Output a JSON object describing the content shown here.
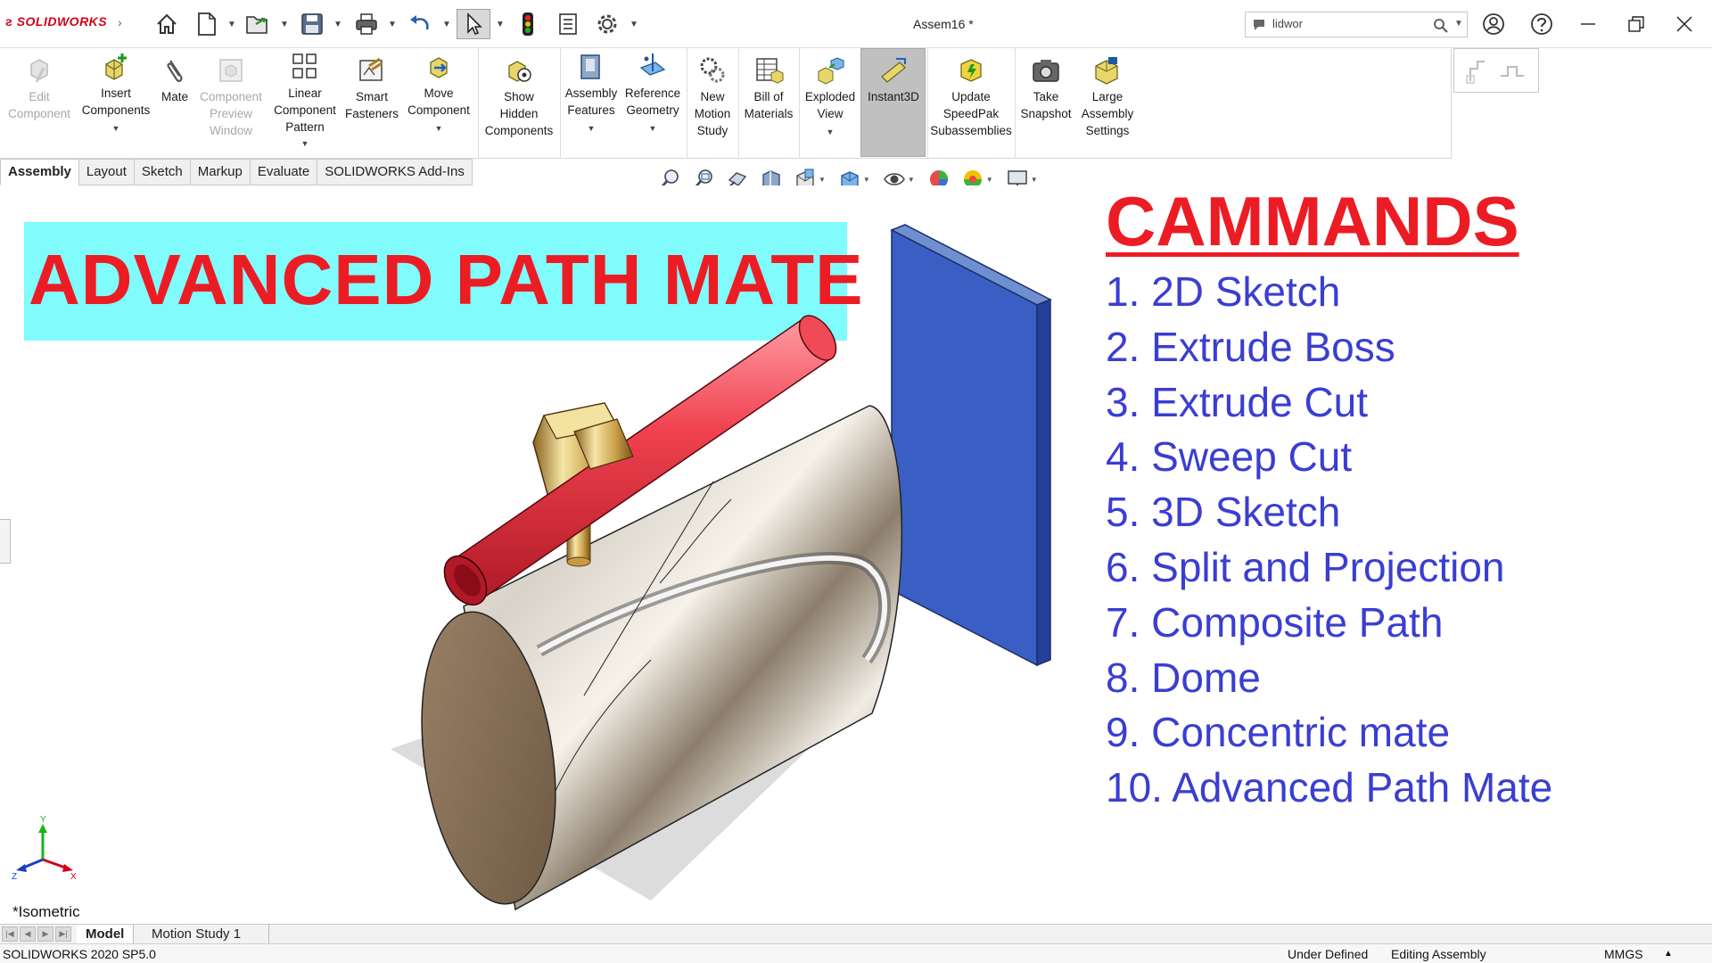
{
  "app": {
    "brand": "SOLIDWORKS",
    "doc_title": "Assem16 *"
  },
  "search": {
    "value": "lidwor"
  },
  "quick_access": {
    "icons": [
      "home-icon",
      "new-document-icon",
      "open-icon",
      "save-icon",
      "print-icon",
      "undo-icon",
      "select-icon",
      "rebuild-icon",
      "file-properties-icon",
      "options-icon"
    ]
  },
  "ribbon": {
    "edit_component": [
      "Edit",
      "Component"
    ],
    "insert_components": [
      "Insert",
      "Components"
    ],
    "mate": [
      "Mate"
    ],
    "component_preview": [
      "Component",
      "Preview",
      "Window"
    ],
    "linear_pattern": [
      "Linear",
      "Component",
      "Pattern"
    ],
    "smart_fasteners": [
      "Smart",
      "Fasteners"
    ],
    "move_component": [
      "Move",
      "Component"
    ],
    "show_hidden": [
      "Show",
      "Hidden",
      "Components"
    ],
    "assembly_features": [
      "Assembly",
      "Features"
    ],
    "reference_geometry": [
      "Reference",
      "Geometry"
    ],
    "new_motion_study": [
      "New",
      "Motion",
      "Study"
    ],
    "bill_of_materials": [
      "Bill of",
      "Materials"
    ],
    "exploded_view": [
      "Exploded",
      "View"
    ],
    "instant3d": [
      "Instant3D"
    ],
    "update_speedpak": [
      "Update",
      "SpeedPak",
      "Subassemblies"
    ],
    "take_snapshot": [
      "Take",
      "Snapshot"
    ],
    "large_assembly": [
      "Large",
      "Assembly",
      "Settings"
    ]
  },
  "tabs": [
    "Assembly",
    "Layout",
    "Sketch",
    "Markup",
    "Evaluate",
    "SOLIDWORKS Add-Ins"
  ],
  "banner": {
    "text": "ADVANCED PATH MATE",
    "bg": "#80fcfc",
    "color": "#ec1c24"
  },
  "commands": {
    "title": "CAMMANDS",
    "items": [
      "1. 2D Sketch",
      "2. Extrude Boss",
      "3. Extrude Cut",
      "4. Sweep Cut",
      "5. 3D Sketch",
      "6. Split and Projection",
      "7. Composite Path",
      "8. Dome",
      "9. Concentric mate",
      "10. Advanced Path Mate"
    ],
    "color": "#3a3ed1"
  },
  "triad": {
    "y": "Y",
    "x": "X",
    "z": "Z"
  },
  "view_name": "*Isometric",
  "bottom_tabs": [
    "Model",
    "Motion Study 1"
  ],
  "status": {
    "version": "SOLIDWORKS 2020 SP5.0",
    "state": "Under Defined",
    "mode": "Editing Assembly",
    "units": "MMGS"
  }
}
